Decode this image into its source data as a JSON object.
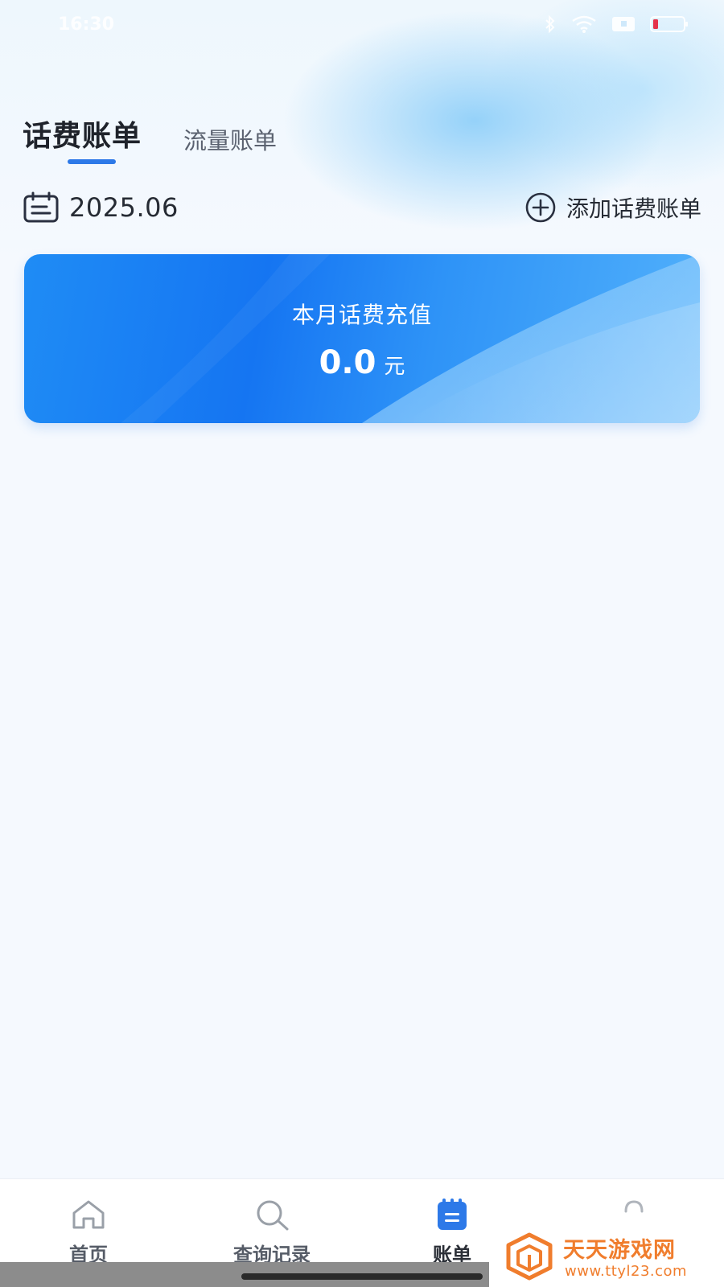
{
  "status_bar": {
    "time": "16:30"
  },
  "tabs": [
    {
      "label": "话费账单",
      "active": true
    },
    {
      "label": "流量账单",
      "active": false
    }
  ],
  "date_row": {
    "date": "2025.06",
    "calendar_icon": "calendar-icon",
    "add_label": "添加话费账单",
    "add_icon": "plus-circle-icon"
  },
  "summary_card": {
    "title": "本月话费充值",
    "amount": "0.0",
    "unit": "元"
  },
  "bottom_nav": [
    {
      "label": "首页",
      "icon": "home-icon",
      "active": false
    },
    {
      "label": "查询记录",
      "icon": "search-icon",
      "active": false
    },
    {
      "label": "账单",
      "icon": "bill-icon",
      "active": true
    },
    {
      "label": "",
      "icon": "profile-icon",
      "active": false
    }
  ],
  "watermark": {
    "name": "天天游戏网",
    "url": "www.ttyl23.com"
  },
  "colors": {
    "accent": "#2d79e8",
    "card_start": "#1575f2",
    "card_end": "#52b1fb",
    "page_bg": "#f5f9fe",
    "watermark": "#f07d2d"
  }
}
